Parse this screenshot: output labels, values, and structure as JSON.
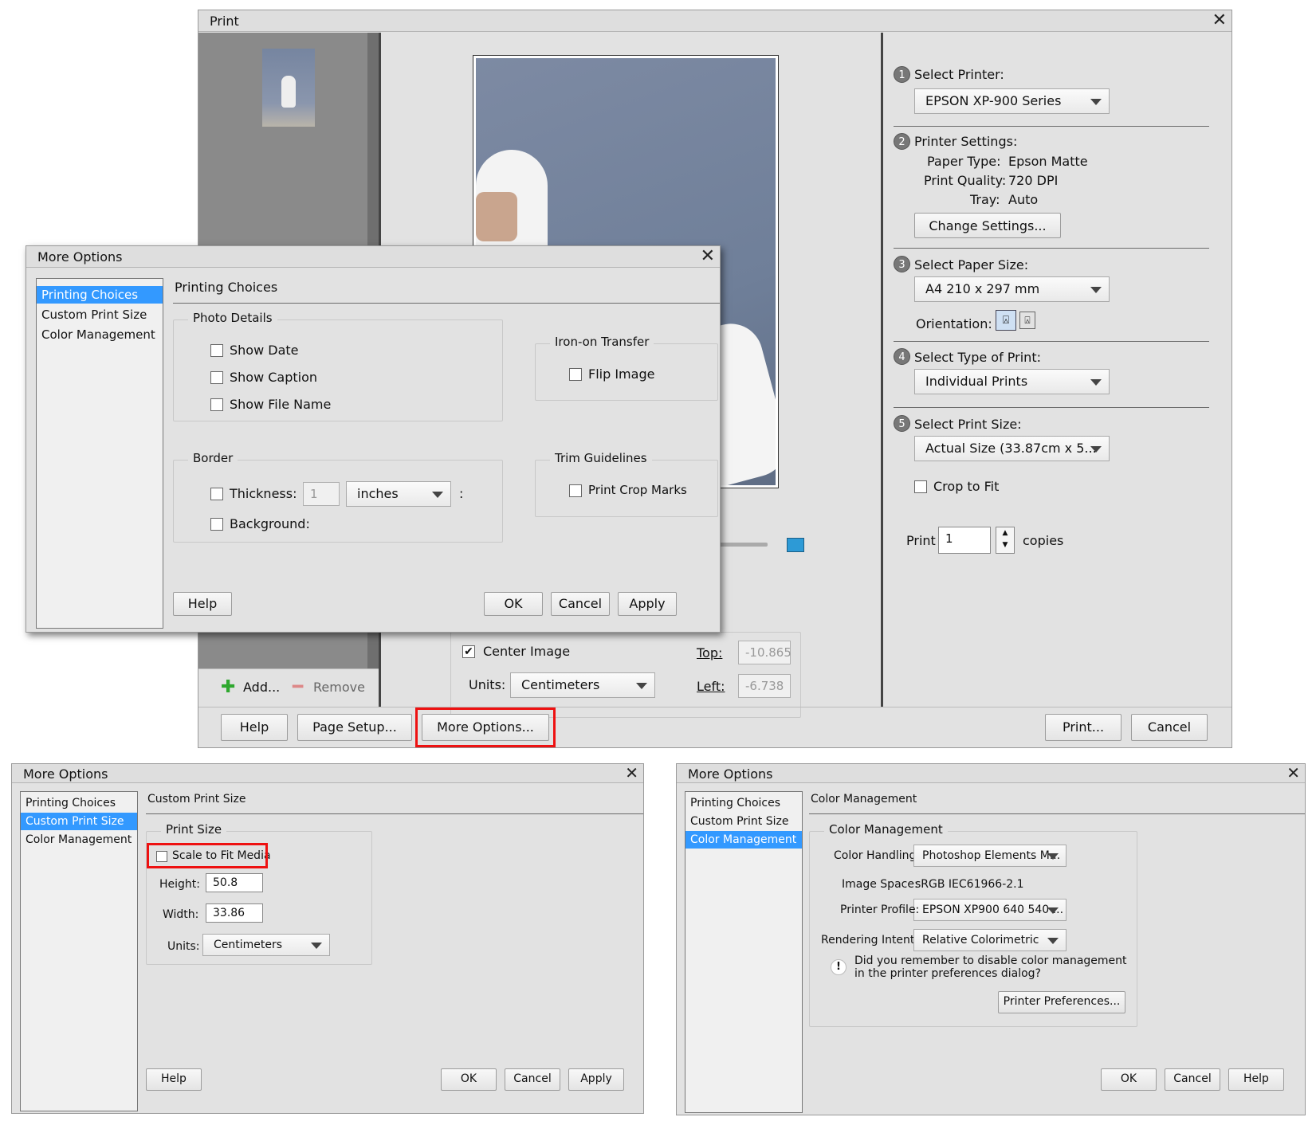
{
  "print": {
    "title": "Print",
    "add_label": "Add...",
    "remove_label": "Remove",
    "center_image_label": "Center Image",
    "units_label": "Units:",
    "units_value": "Centimeters",
    "top_label": "Top:",
    "top_value": "-10.865",
    "left_label": "Left:",
    "left_value": "-6.738",
    "help_label": "Help",
    "page_setup_label": "Page Setup...",
    "more_options_label": "More Options...",
    "print_label": "Print...",
    "cancel_label": "Cancel",
    "step1_num": "1",
    "step1_label": "Select Printer:",
    "printer_value": "EPSON XP-900 Series",
    "step2_num": "2",
    "step2_label": "Printer Settings:",
    "paper_type_label": "Paper Type:",
    "paper_type_value": "Epson Matte",
    "print_quality_label": "Print Quality:",
    "print_quality_value": "720 DPI",
    "tray_label": "Tray:",
    "tray_value": "Auto",
    "change_settings_label": "Change Settings...",
    "step3_num": "3",
    "step3_label": "Select Paper Size:",
    "paper_size_value": "A4 210 x 297 mm",
    "orientation_label": "Orientation:",
    "step4_num": "4",
    "step4_label": "Select Type of Print:",
    "print_type_value": "Individual Prints",
    "step5_num": "5",
    "step5_label": "Select Print Size:",
    "print_size_value": "Actual Size (33.87cm x 5...",
    "crop_to_fit_label": "Crop to Fit",
    "copies_prefix": "Print",
    "copies_value": "1",
    "copies_suffix": "copies"
  },
  "more_options_main": {
    "title": "More Options",
    "nav": [
      "Printing Choices",
      "Custom Print Size",
      "Color Management"
    ],
    "selected_nav": 0,
    "section_title": "Printing Choices",
    "photo_details_title": "Photo Details",
    "show_date_label": "Show Date",
    "show_caption_label": "Show Caption",
    "show_file_name_label": "Show File Name",
    "iron_on_title": "Iron-on Transfer",
    "flip_image_label": "Flip Image",
    "border_title": "Border",
    "thickness_label": "Thickness:",
    "thickness_value": "1",
    "thickness_units": "inches",
    "colon": ":",
    "background_label": "Background:",
    "trim_title": "Trim Guidelines",
    "print_crop_marks_label": "Print Crop Marks",
    "help_label": "Help",
    "ok_label": "OK",
    "cancel_label": "Cancel",
    "apply_label": "Apply"
  },
  "more_options_custom": {
    "title": "More Options",
    "nav": [
      "Printing Choices",
      "Custom Print Size",
      "Color Management"
    ],
    "selected_nav": 1,
    "section_title": "Custom Print Size",
    "print_size_title": "Print Size",
    "scale_label": "Scale to Fit Media",
    "height_label": "Height:",
    "height_value": "50.8",
    "width_label": "Width:",
    "width_value": "33.86",
    "units_label": "Units:",
    "units_value": "Centimeters",
    "help_label": "Help",
    "ok_label": "OK",
    "cancel_label": "Cancel",
    "apply_label": "Apply"
  },
  "more_options_color": {
    "title": "More Options",
    "nav": [
      "Printing Choices",
      "Custom Print Size",
      "Color Management"
    ],
    "selected_nav": 2,
    "section_title": "Color Management",
    "group_title": "Color Management",
    "color_handling_label": "Color Handling:",
    "color_handling_value": "Photoshop Elements M...",
    "image_space_label": "Image Space:",
    "image_space_value": "sRGB IEC61966-2.1",
    "printer_profile_label": "Printer Profile:",
    "printer_profile_value": "EPSON XP900 640 540 ...",
    "rendering_intent_label": "Rendering Intent:",
    "rendering_intent_value": "Relative Colorimetric",
    "warning_line1": "Did you remember to disable color management",
    "warning_line2": "in the printer preferences dialog?",
    "printer_prefs_label": "Printer Preferences...",
    "ok_label": "OK",
    "cancel_label": "Cancel",
    "help_label": "Help"
  },
  "colors": {
    "highlight_red": "#e11111",
    "selection_blue": "#3399ff",
    "photo_bg": "#6f7f99"
  }
}
